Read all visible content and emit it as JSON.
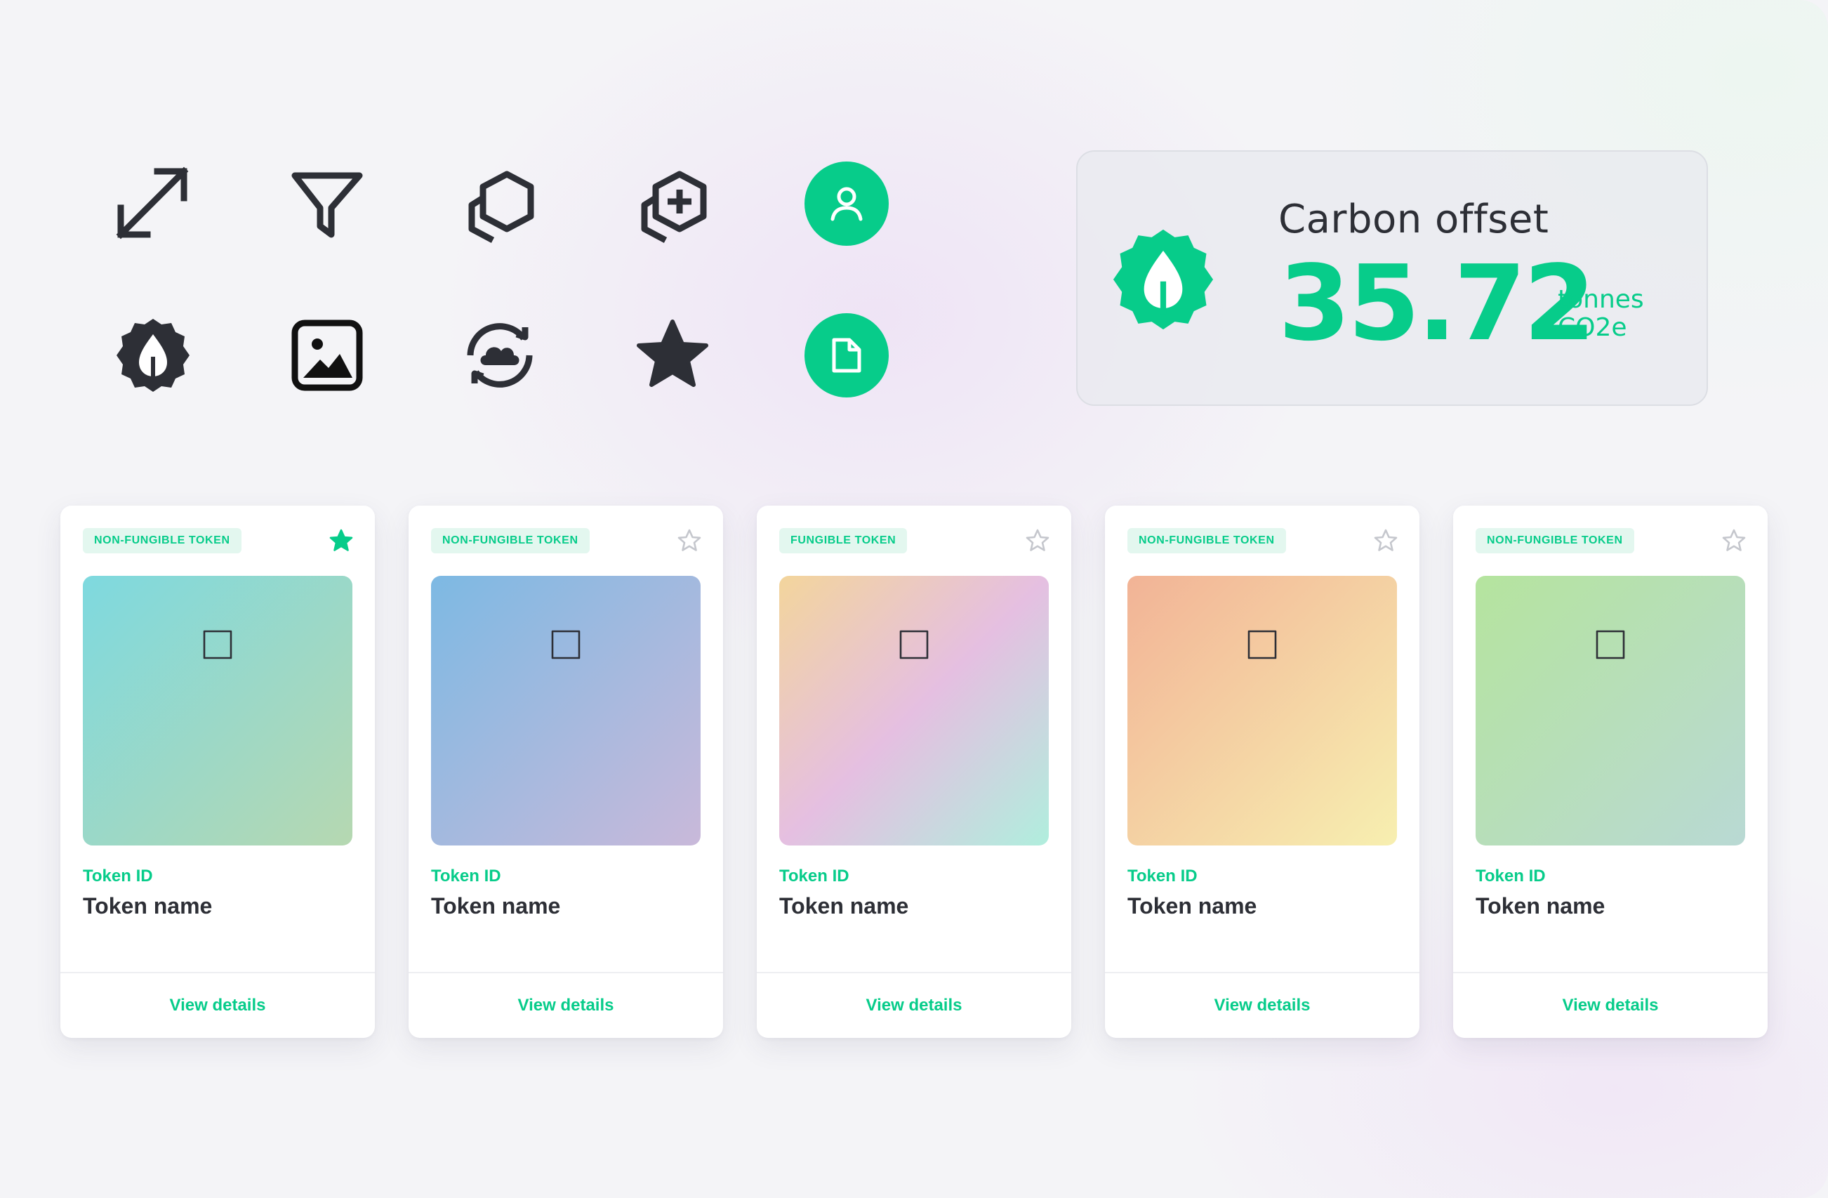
{
  "colors": {
    "accent": "#07CC8A",
    "icon_dark": "#2D2F36",
    "badge_bg": "#E3F7EF",
    "star_outline": "#C5C7CD"
  },
  "icon_grid": [
    {
      "name": "expand-icon"
    },
    {
      "name": "filter-icon"
    },
    {
      "name": "token-stack-icon"
    },
    {
      "name": "add-token-icon"
    },
    {
      "name": "user-icon",
      "style": "green-circle"
    },
    {
      "name": "carbon-leaf-badge-icon"
    },
    {
      "name": "image-icon"
    },
    {
      "name": "cloud-sync-icon"
    },
    {
      "name": "star-filled-icon"
    },
    {
      "name": "document-icon",
      "style": "green-circle"
    }
  ],
  "carbon_offset": {
    "title": "Carbon offset",
    "value": "35.72",
    "unit_line1": "tonnes",
    "unit_line2": "CO2e",
    "icon": "leaf-badge-icon"
  },
  "cards": [
    {
      "badge": "NON-FUNGIBLE TOKEN",
      "favorited": true,
      "token_id": "Token ID",
      "token_name": "Token name",
      "action": "View details",
      "gradient": [
        "#7ED9DF",
        "#B6D8B1"
      ]
    },
    {
      "badge": "NON-FUNGIBLE TOKEN",
      "favorited": false,
      "token_id": "Token ID",
      "token_name": "Token name",
      "action": "View details",
      "gradient": [
        "#7DB9E3",
        "#C9B9DA"
      ]
    },
    {
      "badge": "FUNGIBLE TOKEN",
      "favorited": false,
      "token_id": "Token ID",
      "token_name": "Token name",
      "action": "View details",
      "gradient": [
        "#F3D59C",
        "#E5BFE1",
        "#B0EEDD"
      ]
    },
    {
      "badge": "NON-FUNGIBLE TOKEN",
      "favorited": false,
      "token_id": "Token ID",
      "token_name": "Token name",
      "action": "View details",
      "gradient": [
        "#F2B396",
        "#F7EFB0"
      ]
    },
    {
      "badge": "NON-FUNGIBLE TOKEN",
      "favorited": false,
      "token_id": "Token ID",
      "token_name": "Token name",
      "action": "View details",
      "gradient": [
        "#B5E49E",
        "#B9D9D4"
      ]
    }
  ]
}
